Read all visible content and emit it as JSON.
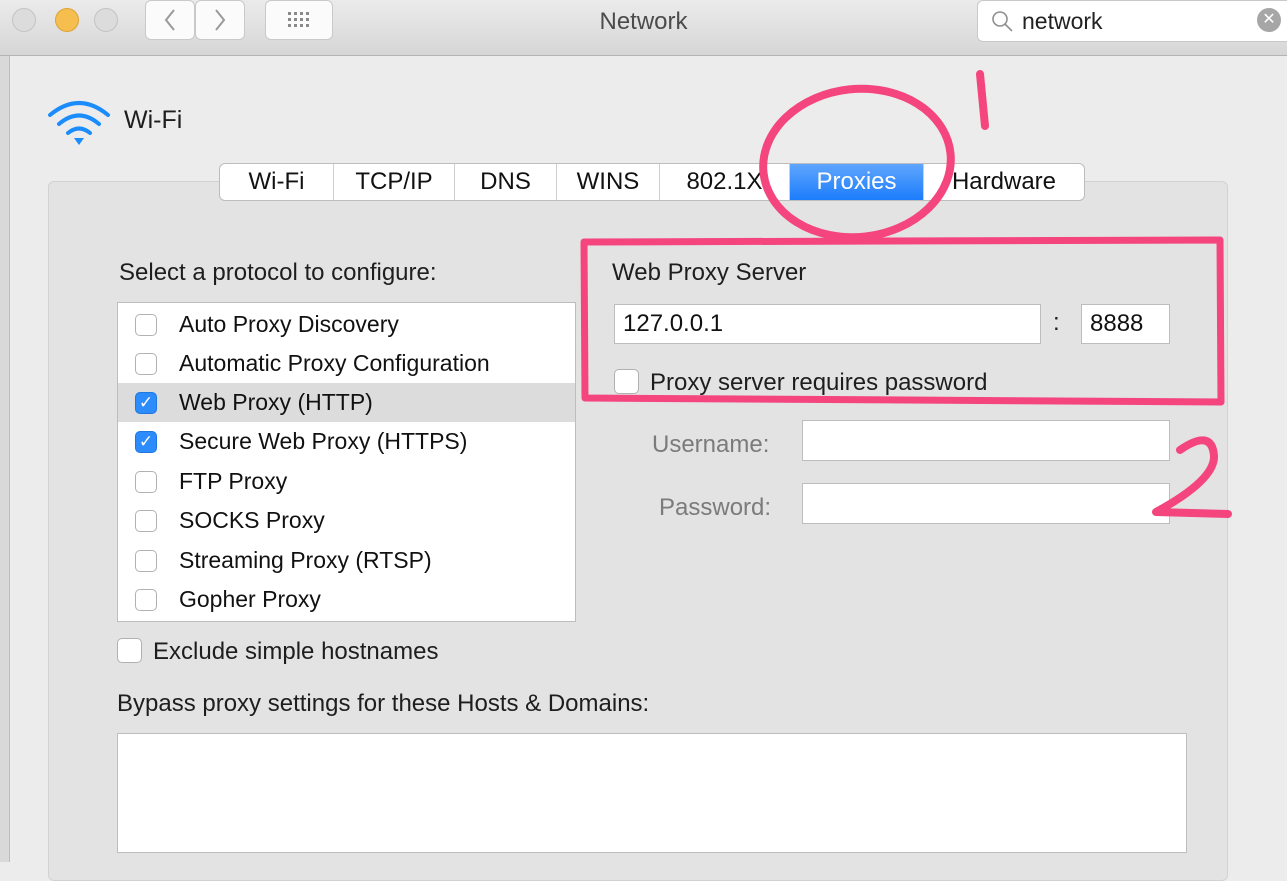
{
  "window": {
    "title": "Network"
  },
  "search": {
    "value": "network"
  },
  "service": {
    "name": "Wi-Fi"
  },
  "tabs": [
    {
      "label": "Wi-Fi",
      "active": false
    },
    {
      "label": "TCP/IP",
      "active": false
    },
    {
      "label": "DNS",
      "active": false
    },
    {
      "label": "WINS",
      "active": false
    },
    {
      "label": "802.1X",
      "active": false
    },
    {
      "label": "Proxies",
      "active": true
    },
    {
      "label": "Hardware",
      "active": false
    }
  ],
  "protocols": {
    "heading": "Select a protocol to configure:",
    "items": [
      {
        "label": "Auto Proxy Discovery",
        "checked": false,
        "selected": false
      },
      {
        "label": "Automatic Proxy Configuration",
        "checked": false,
        "selected": false
      },
      {
        "label": "Web Proxy (HTTP)",
        "checked": true,
        "selected": true
      },
      {
        "label": "Secure Web Proxy (HTTPS)",
        "checked": true,
        "selected": false
      },
      {
        "label": "FTP Proxy",
        "checked": false,
        "selected": false
      },
      {
        "label": "SOCKS Proxy",
        "checked": false,
        "selected": false
      },
      {
        "label": "Streaming Proxy (RTSP)",
        "checked": false,
        "selected": false
      },
      {
        "label": "Gopher Proxy",
        "checked": false,
        "selected": false
      }
    ]
  },
  "proxy": {
    "heading": "Web Proxy Server",
    "server": "127.0.0.1",
    "separator": ":",
    "port": "8888",
    "requires_password_label": "Proxy server requires password",
    "requires_password": false,
    "username_label": "Username:",
    "username": "",
    "password_label": "Password:",
    "password": ""
  },
  "exclude_simple_hostnames": {
    "label": "Exclude simple hostnames",
    "checked": false
  },
  "bypass": {
    "label": "Bypass proxy settings for these Hosts & Domains:",
    "value": ""
  },
  "annotations": {
    "color": "#f4457f",
    "marks": [
      "1",
      "2"
    ]
  },
  "colors": {
    "accent": "#2d8cfb",
    "annotation": "#f4457f"
  },
  "icons": {
    "back": "chevron-left-icon",
    "forward": "chevron-right-icon",
    "grid": "grid-icon",
    "search": "search-icon",
    "clear": "clear-icon",
    "wifi": "wifi-icon",
    "check": "checkmark-icon"
  }
}
